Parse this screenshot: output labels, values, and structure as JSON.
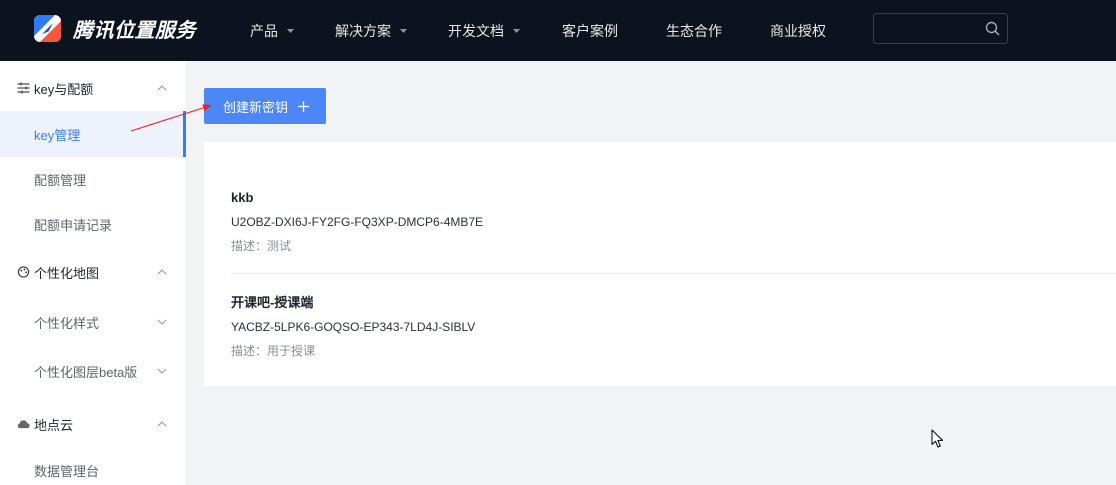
{
  "header": {
    "logo_text": "腾讯位置服务",
    "logo_icon": "tencent-map-logo-icon",
    "nav": [
      {
        "label": "产品",
        "dropdown": true
      },
      {
        "label": "解决方案",
        "dropdown": true
      },
      {
        "label": "开发文档",
        "dropdown": true
      },
      {
        "label": "客户案例",
        "dropdown": false
      },
      {
        "label": "生态合作",
        "dropdown": false
      },
      {
        "label": "商业授权",
        "dropdown": false
      }
    ],
    "search": {
      "value": "",
      "icon": "search-icon"
    }
  },
  "sidebar": {
    "groups": [
      {
        "label": "key与配额",
        "icon": "sliders-icon",
        "expanded": true,
        "items": [
          {
            "label": "key管理",
            "active": true
          },
          {
            "label": "配额管理"
          },
          {
            "label": "配额申请记录"
          }
        ]
      },
      {
        "label": "个性化地图",
        "icon": "palette-icon",
        "expanded": true,
        "items": [
          {
            "label": "个性化样式",
            "expandable": true
          },
          {
            "label": "个性化图层beta版",
            "expandable": true
          }
        ]
      },
      {
        "label": "地点云",
        "icon": "cloud-icon",
        "expanded": true,
        "items": [
          {
            "label": "数据管理台"
          }
        ]
      }
    ]
  },
  "main": {
    "create_button": {
      "label": "创建新密钥",
      "icon": "plus-icon"
    },
    "description_label": "描述：",
    "keys": [
      {
        "name": "kkb",
        "key": "U2OBZ-DXI6J-FY2FG-FQ3XP-DMCP6-4MB7E",
        "description": "测试"
      },
      {
        "name": "开课吧-授课端",
        "key": "YACBZ-5LPK6-GOQSO-EP343-7LD4J-SIBLV",
        "description": "用于授课"
      }
    ]
  },
  "colors": {
    "nav_bg": "#0c121e",
    "accent": "#4d86f7",
    "active_text": "#3b7cf0",
    "active_bg": "#edf2fd",
    "content_bg": "#f2f3f5",
    "annotation": "#e8231d"
  }
}
